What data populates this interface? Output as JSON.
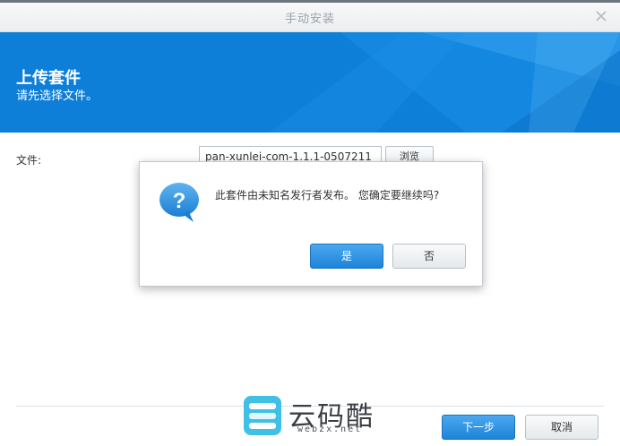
{
  "window": {
    "title": "手动安装"
  },
  "banner": {
    "title": "上传套件",
    "subtitle": "请先选择文件。"
  },
  "form": {
    "file_label": "文件:",
    "file_value": "pan-xunlei-com-1.1.1-0507211",
    "browse_label": "浏览"
  },
  "footer": {
    "next_label": "下一步",
    "cancel_label": "取消"
  },
  "dialog": {
    "message": "此套件由未知名发行者发布。 您确定要继续吗?",
    "yes_label": "是",
    "no_label": "否"
  },
  "watermark": {
    "name": "云码酷",
    "url": "webzx.net"
  },
  "colors": {
    "accent": "#0e7fd9",
    "primary_button": "#2a8fe0"
  },
  "icons": {
    "close": "close-icon",
    "question": "question-bubble-icon",
    "logo": "watermark-logo-icon"
  }
}
